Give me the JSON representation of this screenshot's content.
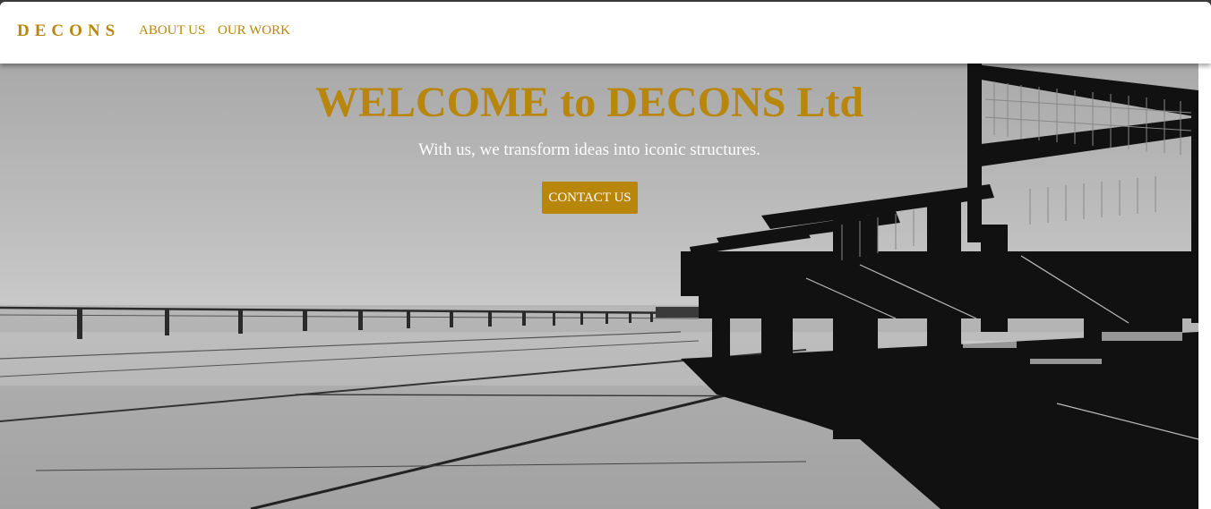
{
  "navbar": {
    "brand": "DECONS",
    "links": [
      {
        "label": "ABOUT US"
      },
      {
        "label": "OUR WORK"
      }
    ]
  },
  "hero": {
    "title": "WELCOME to DECONS Ltd",
    "subtitle": "With us, we transform ideas into iconic structures.",
    "cta_label": "CONTACT US"
  },
  "colors": {
    "accent": "#b8860b",
    "nav_bg": "#ffffff",
    "hero_text": "#ffffff"
  }
}
